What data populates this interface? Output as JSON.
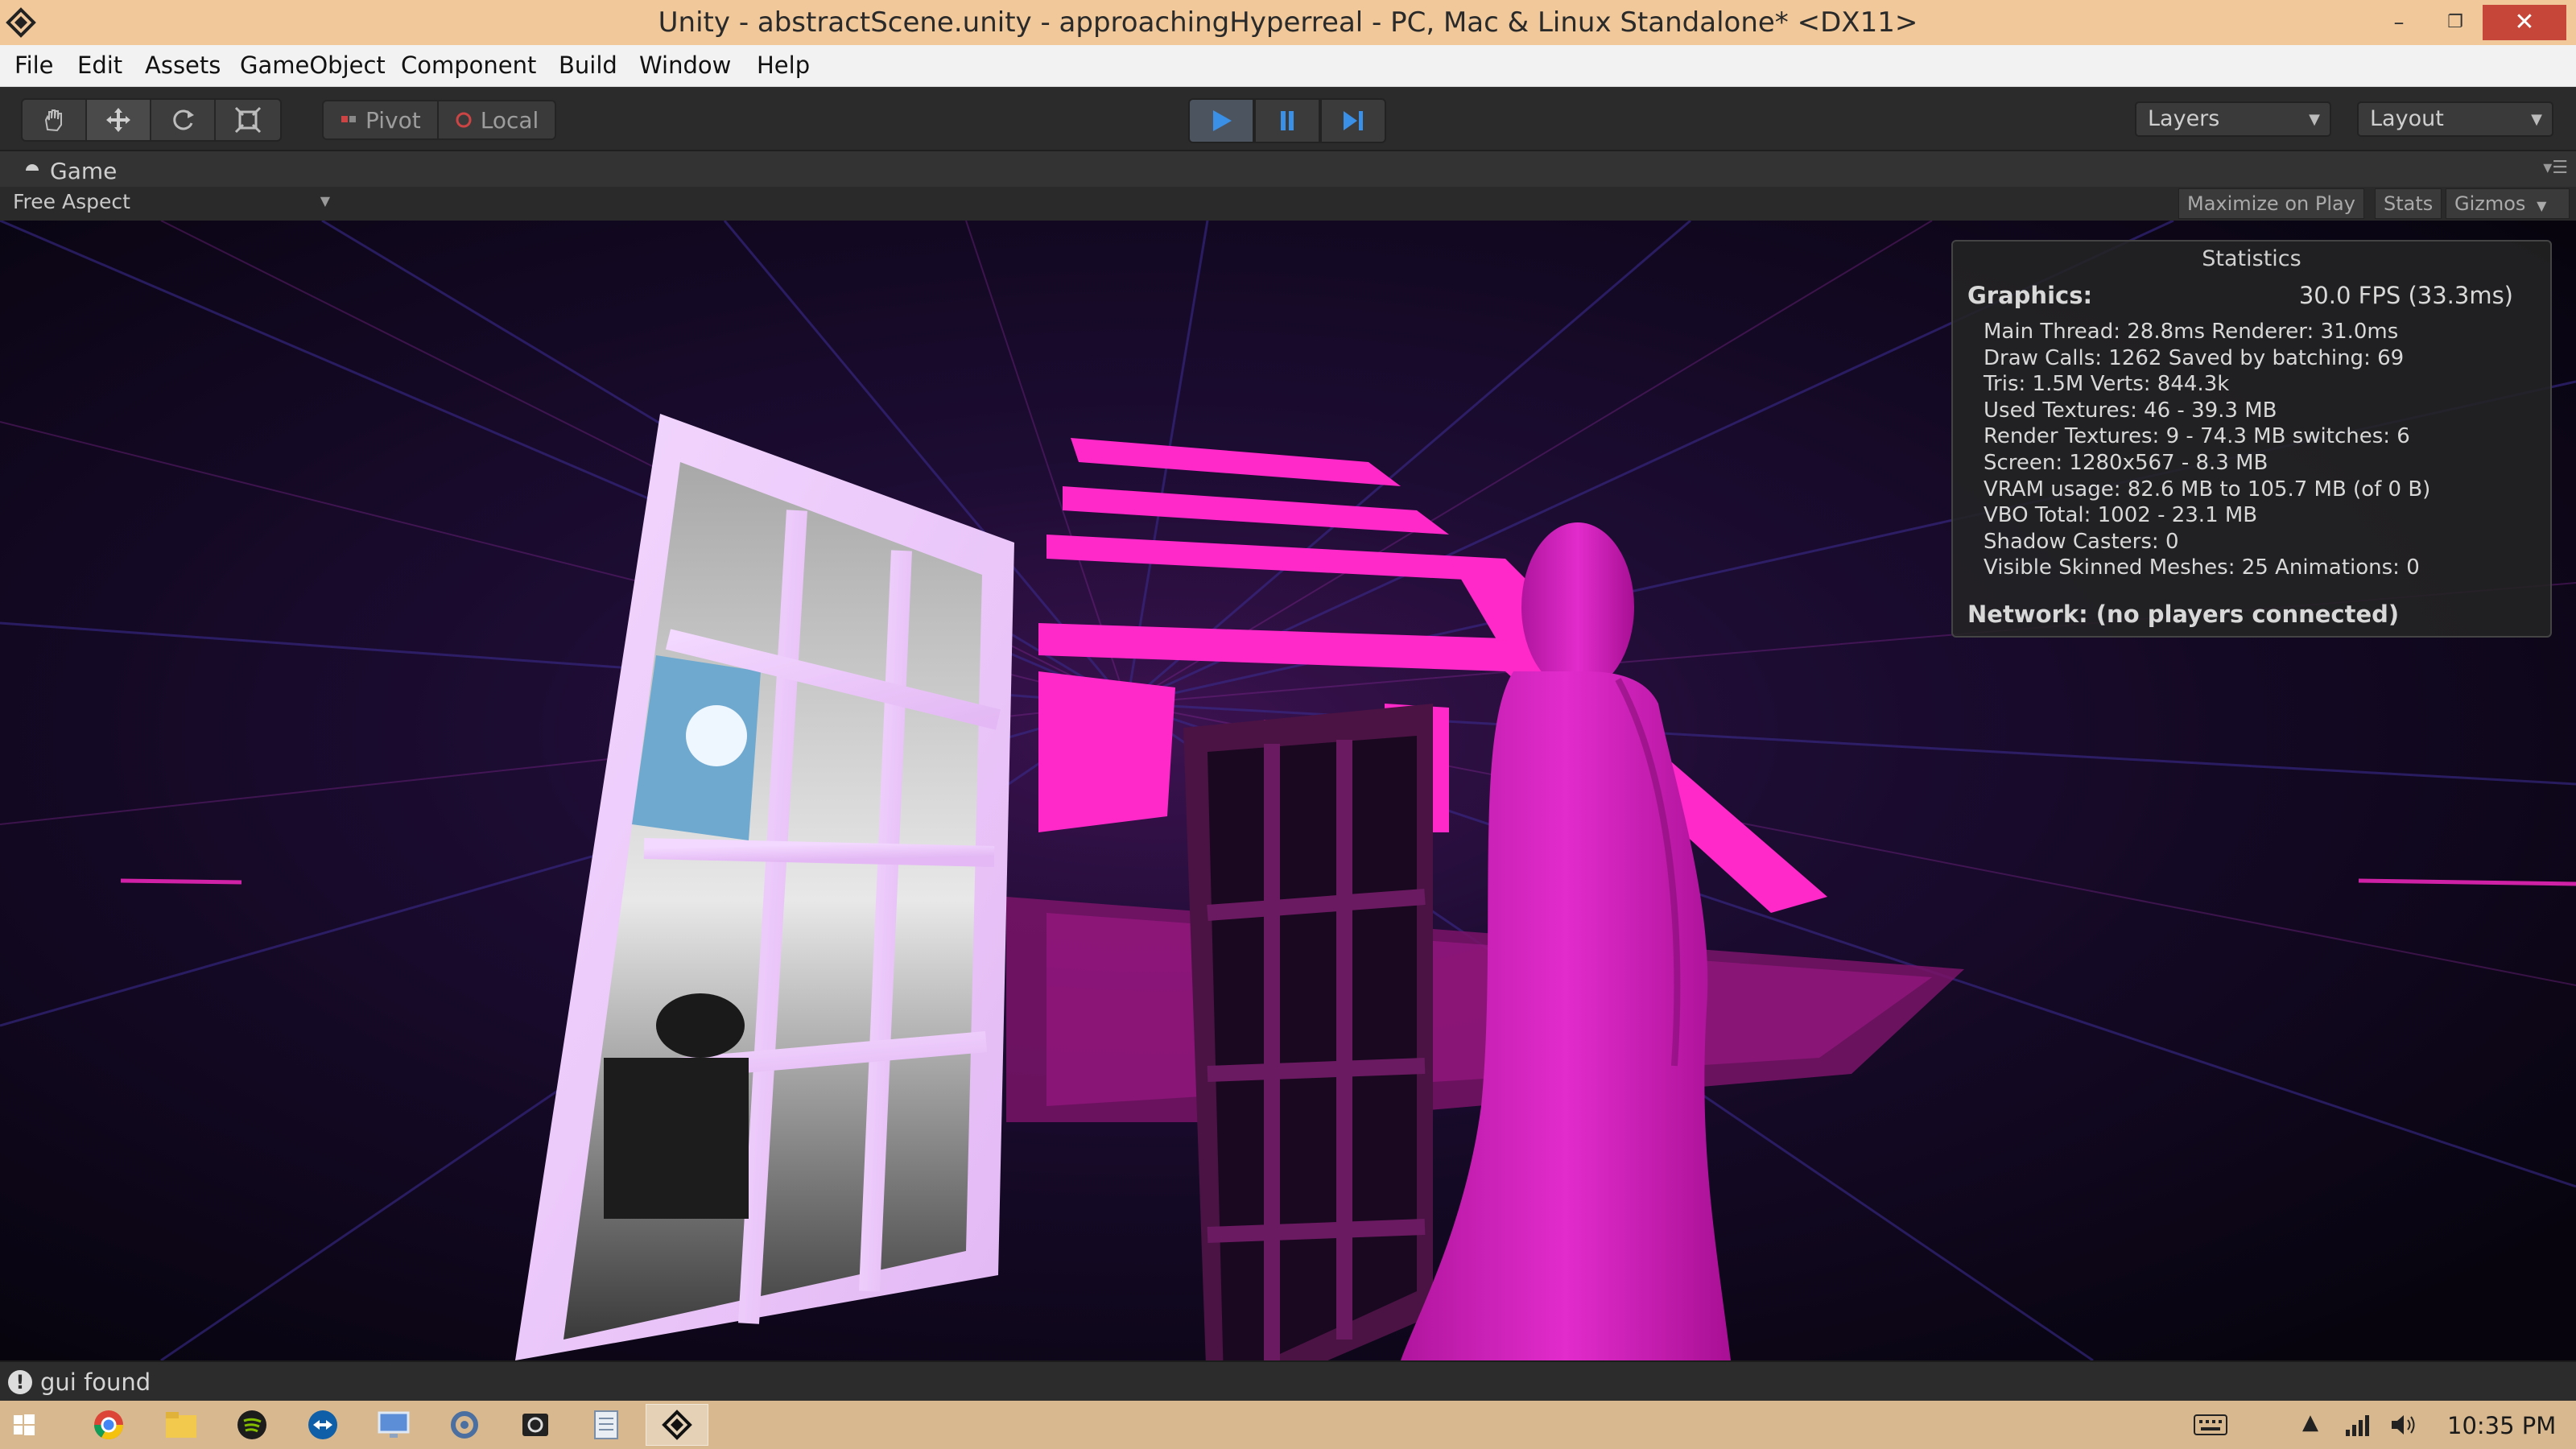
{
  "window": {
    "title": "Unity - abstractScene.unity - approachingHyperreal - PC, Mac & Linux Standalone* <DX11>",
    "controls": {
      "minimize": "–",
      "maximize": "❐",
      "close": "✕"
    }
  },
  "menu": [
    "File",
    "Edit",
    "Assets",
    "GameObject",
    "Component",
    "Build",
    "Window",
    "Help"
  ],
  "toolbar": {
    "transform_tools": [
      "hand-icon",
      "move-icon",
      "rotate-icon",
      "scale-icon"
    ],
    "pivot_label": "Pivot",
    "local_label": "Local",
    "play_controls": [
      "play-icon",
      "pause-icon",
      "step-icon"
    ],
    "layers_label": "Layers",
    "layout_label": "Layout"
  },
  "game_panel": {
    "tab_label": "Game",
    "aspect": "Free Aspect",
    "maximize_label": "Maximize on Play",
    "stats_label": "Stats",
    "gizmos_label": "Gizmos"
  },
  "stats": {
    "title": "Statistics",
    "graphics_label": "Graphics:",
    "fps": "30.0 FPS (33.3ms)",
    "lines": [
      "Main Thread: 28.8ms  Renderer: 31.0ms",
      "Draw Calls: 1262 Saved by batching: 69",
      "Tris: 1.5M    Verts: 844.3k",
      "Used Textures: 46 - 39.3 MB",
      "Render Textures: 9 - 74.3 MB    switches: 6",
      "Screen: 1280x567 - 8.3 MB",
      "VRAM usage: 82.6 MB to 105.7 MB (of 0 B)",
      "VBO Total: 1002 - 23.1 MB",
      "Shadow Casters: 0",
      "Visible Skinned Meshes: 25     Animations: 0"
    ],
    "network": "Network: (no players connected)"
  },
  "status": {
    "message": "gui found"
  },
  "taskbar": {
    "apps": [
      "start-icon",
      "chrome-icon",
      "explorer-icon",
      "spotify-icon",
      "teamviewer-icon",
      "remote-desktop-icon",
      "settings-app-icon",
      "camera-icon",
      "notepad-icon",
      "unity-icon"
    ],
    "clock": "10:35 PM"
  },
  "colors": {
    "accent": "#f0c89a",
    "scene_magenta": "#ff28c8",
    "scene_bg": "#0a0612"
  }
}
